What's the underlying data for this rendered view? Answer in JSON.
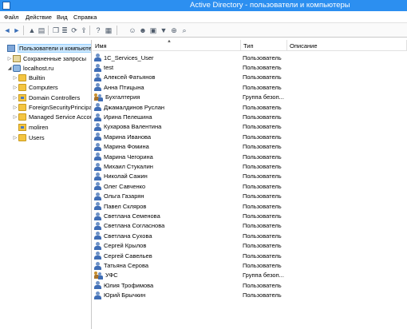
{
  "window": {
    "title": "Active Directory - пользователи и компьютеры"
  },
  "menu": [
    "Файл",
    "Действие",
    "Вид",
    "Справка"
  ],
  "toolbar": {
    "buttons": [
      {
        "name": "back-icon",
        "glyph": "◄"
      },
      {
        "name": "forward-icon",
        "glyph": "►"
      },
      {
        "name": "up-folder-icon",
        "glyph": "▲"
      },
      {
        "name": "show-tree-icon",
        "glyph": "▤"
      },
      {
        "name": "copy-icon",
        "glyph": "❐"
      },
      {
        "name": "properties-icon",
        "glyph": "≣"
      },
      {
        "name": "refresh-icon",
        "glyph": "⟳"
      },
      {
        "name": "export-list-icon",
        "glyph": "⇪"
      },
      {
        "name": "help-icon",
        "glyph": "?"
      },
      {
        "name": "detail-view-icon",
        "glyph": "▦"
      },
      {
        "name": "new-user-icon",
        "glyph": "☺"
      },
      {
        "name": "new-group-icon",
        "glyph": "☻"
      },
      {
        "name": "new-ou-icon",
        "glyph": "▣"
      },
      {
        "name": "filter-icon",
        "glyph": "▼"
      },
      {
        "name": "add-to-group-icon",
        "glyph": "⊕"
      },
      {
        "name": "find-icon",
        "glyph": "⌕"
      }
    ]
  },
  "tree": [
    {
      "label": "Пользователи и компьютеры",
      "icon": "root",
      "level": 0,
      "expander": "",
      "selected": true
    },
    {
      "label": "Сохраненные запросы",
      "icon": "saved",
      "level": 1,
      "expander": "▷",
      "selected": false
    },
    {
      "label": "localhost.ru",
      "icon": "domain",
      "level": 1,
      "expander": "◢",
      "selected": false
    },
    {
      "label": "Builtin",
      "icon": "folder",
      "level": 2,
      "expander": "▷",
      "selected": false
    },
    {
      "label": "Computers",
      "icon": "folder",
      "level": 2,
      "expander": "▷",
      "selected": false
    },
    {
      "label": "Domain Controllers",
      "icon": "ou",
      "level": 2,
      "expander": "▷",
      "selected": false
    },
    {
      "label": "ForeignSecurityPrincipals",
      "icon": "folder",
      "level": 2,
      "expander": "▷",
      "selected": false
    },
    {
      "label": "Managed Service Accour",
      "icon": "folder",
      "level": 2,
      "expander": "▷",
      "selected": false
    },
    {
      "label": "moliren",
      "icon": "ou",
      "level": 2,
      "expander": "",
      "selected": false
    },
    {
      "label": "Users",
      "icon": "folder",
      "level": 2,
      "expander": "▷",
      "selected": false
    }
  ],
  "list": {
    "columns": [
      "Имя",
      "Тип",
      "Описание"
    ],
    "rows": [
      {
        "name": "1C_Services_User",
        "type": "Пользователь",
        "description": "",
        "kind": "user"
      },
      {
        "name": "test",
        "type": "Пользователь",
        "description": "",
        "kind": "user"
      },
      {
        "name": "Алексей Фатьянов",
        "type": "Пользователь",
        "description": "",
        "kind": "user"
      },
      {
        "name": "Анна Птицына",
        "type": "Пользователь",
        "description": "",
        "kind": "user"
      },
      {
        "name": "Бухгалтерия",
        "type": "Группа безоп...",
        "description": "",
        "kind": "group"
      },
      {
        "name": "Джамалдинов Руслан",
        "type": "Пользователь",
        "description": "",
        "kind": "user"
      },
      {
        "name": "Ирина Пелешина",
        "type": "Пользователь",
        "description": "",
        "kind": "user"
      },
      {
        "name": "Кухарова Валентина",
        "type": "Пользователь",
        "description": "",
        "kind": "user"
      },
      {
        "name": "Марина Иванова",
        "type": "Пользователь",
        "description": "",
        "kind": "user"
      },
      {
        "name": "Марина Фомина",
        "type": "Пользователь",
        "description": "",
        "kind": "user"
      },
      {
        "name": "Марина Чегорина",
        "type": "Пользователь",
        "description": "",
        "kind": "user"
      },
      {
        "name": "Михаил Стукалин",
        "type": "Пользователь",
        "description": "",
        "kind": "user"
      },
      {
        "name": "Николай Сажин",
        "type": "Пользователь",
        "description": "",
        "kind": "user"
      },
      {
        "name": "Олег Савченко",
        "type": "Пользователь",
        "description": "",
        "kind": "user"
      },
      {
        "name": "Ольга Газарян",
        "type": "Пользователь",
        "description": "",
        "kind": "user"
      },
      {
        "name": "Павел Скляров",
        "type": "Пользователь",
        "description": "",
        "kind": "user"
      },
      {
        "name": "Светлана Семенова",
        "type": "Пользователь",
        "description": "",
        "kind": "user"
      },
      {
        "name": "Светлана Согласнова",
        "type": "Пользователь",
        "description": "",
        "kind": "user"
      },
      {
        "name": "Светлана Сухова",
        "type": "Пользователь",
        "description": "",
        "kind": "user"
      },
      {
        "name": "Сергей Крылов",
        "type": "Пользователь",
        "description": "",
        "kind": "user"
      },
      {
        "name": "Сергей Савельев",
        "type": "Пользователь",
        "description": "",
        "kind": "user"
      },
      {
        "name": "Татьяна Серова",
        "type": "Пользователь",
        "description": "",
        "kind": "user"
      },
      {
        "name": "УФС",
        "type": "Группа безоп...",
        "description": "",
        "kind": "group"
      },
      {
        "name": "Юлия Трофимова",
        "type": "Пользователь",
        "description": "",
        "kind": "user"
      },
      {
        "name": "Юрий Брычкин",
        "type": "Пользователь",
        "description": "",
        "kind": "user"
      }
    ]
  }
}
